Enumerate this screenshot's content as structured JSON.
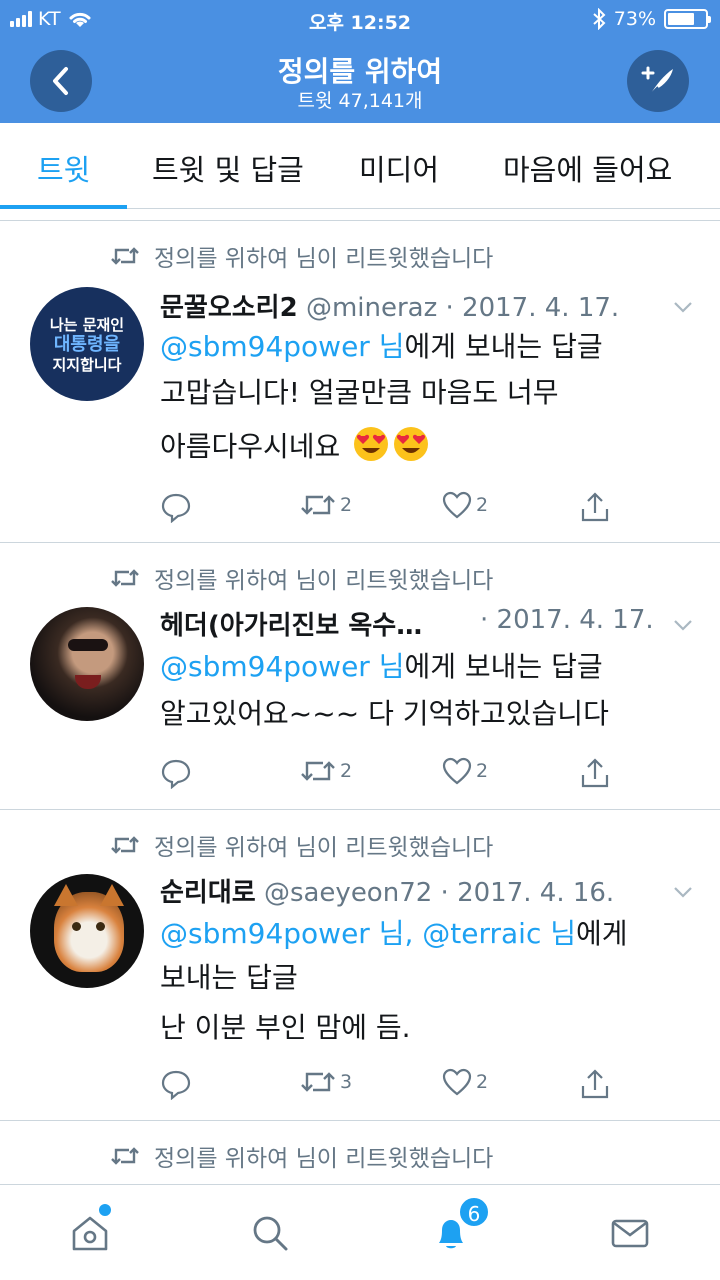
{
  "status_bar": {
    "carrier": "KT",
    "time": "오후 12:52",
    "battery": "73%",
    "battery_level": 0.73
  },
  "header": {
    "title": "정의를 위하여",
    "subtitle": "트윗 47,141개"
  },
  "tabs": [
    "트윗",
    "트윗 및 답글",
    "미디어",
    "마음에 들어요"
  ],
  "tweets": [
    {
      "retweet_label": "정의를 위하여 님이 리트윗했습니다",
      "name": "문꿀오소리2",
      "meta": "@mineraz · 2017. 4. 17.",
      "avatar_text": [
        "나는 문재인",
        "대통령을",
        "지지합니다"
      ],
      "reply_prefix": "@sbm94power 님",
      "reply_suffix": "에게 보내는 답글",
      "lines": [
        "고맙습니다! 얼굴만큼 마음도 너무",
        "아름다우시네요"
      ],
      "retweets": "2",
      "likes": "2"
    },
    {
      "retweet_label": "정의를 위하여 님이 리트윗했습니다",
      "name": "헤더(아가리진보 옥수…",
      "meta": "· 2017. 4. 17.",
      "reply_prefix": "@sbm94power 님",
      "reply_suffix": "에게 보내는 답글",
      "lines": [
        "알고있어요~~~  다 기억하고있습니다"
      ],
      "retweets": "2",
      "likes": "2"
    },
    {
      "retweet_label": "정의를 위하여 님이 리트윗했습니다",
      "name": "순리대로",
      "meta": "@saeyeon72 · 2017. 4. 16.",
      "reply_prefix": "@sbm94power 님, @terraic 님",
      "reply_suffix": "에게",
      "reply_line2": "보내는 답글",
      "lines": [
        "난 이분 부인 맘에 듬."
      ],
      "retweets": "3",
      "likes": "2"
    },
    {
      "retweet_label": "정의를 위하여 님이 리트윗했습니다"
    }
  ],
  "bottom_nav": {
    "notification_count": "6"
  },
  "colors": {
    "header": "#4a90e2",
    "accent": "#1da1f2",
    "muted": "#657786"
  }
}
